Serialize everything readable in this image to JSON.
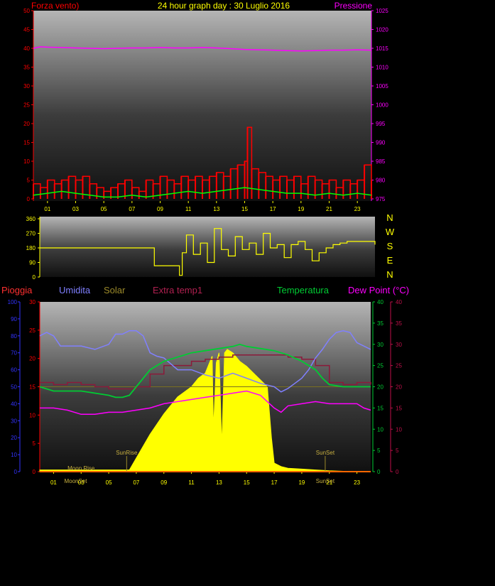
{
  "title": "24 hour graph day : 30 Luglio 2016",
  "colors": {
    "background": "#000000",
    "wind": "#ff0000",
    "gust": "#ffffff",
    "avg_wind": "#00ff00",
    "pressure": "#ff00ff",
    "direction": "#ffff00",
    "rain": "#3333ff",
    "humidity": "#8080ff",
    "solar": "#ffff00",
    "extra_temp": "#8b1a3a",
    "temperature": "#00cc33",
    "dew_point": "#ff00ff",
    "axis_label": "#ffff00"
  },
  "chart_data": [
    {
      "type": "line",
      "name": "wind-pressure",
      "labels": {
        "left": "Forza vento)",
        "right": "Pressione"
      },
      "x_ticks": [
        "01",
        "03",
        "05",
        "07",
        "09",
        "11",
        "13",
        "15",
        "17",
        "19",
        "21",
        "23"
      ],
      "x_tick_hours": [
        1,
        3,
        5,
        7,
        9,
        11,
        13,
        15,
        17,
        19,
        21,
        23
      ],
      "xlim": [
        0,
        24
      ],
      "left_axis": {
        "ticks": [
          0,
          5,
          10,
          15,
          20,
          25,
          30,
          35,
          40,
          45,
          50
        ],
        "ylim": [
          0,
          50
        ]
      },
      "right_axis": {
        "ticks": [
          975,
          980,
          985,
          990,
          995,
          1000,
          1005,
          1010,
          1015,
          1020,
          1025
        ],
        "ylim": [
          975,
          1025
        ]
      },
      "series": [
        {
          "key": "wind_max",
          "axis": "left",
          "x": [
            0,
            0.5,
            1,
            1.5,
            2,
            2.5,
            3,
            3.5,
            4,
            4.5,
            5,
            5.5,
            6,
            6.5,
            7,
            7.5,
            8,
            8.5,
            9,
            9.5,
            10,
            10.5,
            11,
            11.5,
            12,
            12.5,
            13,
            13.5,
            14,
            14.5,
            15,
            15.2,
            15.5,
            16,
            16.5,
            17,
            17.5,
            18,
            18.5,
            19,
            19.5,
            20,
            20.5,
            21,
            21.5,
            22,
            22.5,
            23,
            23.5,
            24
          ],
          "y": [
            4,
            3,
            5,
            4,
            5,
            6,
            5,
            6,
            4,
            3,
            2,
            3,
            4,
            5,
            3,
            2,
            5,
            4,
            6,
            5,
            4,
            6,
            5,
            6,
            5,
            6,
            7,
            6,
            8,
            9,
            10,
            19,
            8,
            7,
            6,
            5,
            6,
            5,
            6,
            4,
            6,
            5,
            4,
            5,
            3,
            5,
            4,
            5,
            9,
            5
          ]
        },
        {
          "key": "wind_avg",
          "axis": "left",
          "x": [
            0,
            1,
            2,
            3,
            4,
            5,
            6,
            7,
            8,
            9,
            10,
            11,
            12,
            13,
            14,
            15,
            16,
            17,
            18,
            19,
            20,
            21,
            22,
            23,
            24
          ],
          "y": [
            1,
            1.5,
            2,
            1.5,
            1,
            0.5,
            0.5,
            1,
            0.5,
            1,
            1.5,
            2,
            1.5,
            2,
            2.5,
            3,
            2.5,
            2,
            1.5,
            1.5,
            1,
            1.5,
            1,
            1.5,
            1
          ]
        },
        {
          "key": "pressure",
          "axis": "right",
          "x": [
            0,
            0.5,
            1,
            2,
            3,
            4,
            5,
            6,
            7,
            8,
            9,
            10,
            11,
            12,
            13,
            14,
            15,
            16,
            17,
            18,
            19,
            20,
            21,
            22,
            23,
            24
          ],
          "y": [
            1015,
            1015.4,
            1015.3,
            1015.2,
            1015.1,
            1015,
            1014.9,
            1015,
            1015.1,
            1015.1,
            1015.2,
            1015.1,
            1015.1,
            1015.2,
            1015.1,
            1014.9,
            1014.7,
            1014.6,
            1014.5,
            1014.4,
            1014.3,
            1014.4,
            1014.5,
            1014.5,
            1014.6,
            1014.5
          ]
        }
      ]
    },
    {
      "type": "line",
      "name": "wind-direction",
      "labels": {
        "compass": [
          "N",
          "W",
          "S",
          "E",
          "N"
        ]
      },
      "xlim": [
        0,
        24
      ],
      "y_axis": {
        "ticks": [
          0,
          90,
          180,
          270,
          360
        ],
        "ylim": [
          0,
          360
        ]
      },
      "series": [
        {
          "key": "direction",
          "x": [
            0,
            1,
            2,
            3,
            4,
            5,
            6,
            7,
            8,
            8.2,
            9,
            9.5,
            10,
            10.2,
            10.5,
            11,
            11.5,
            12,
            12.5,
            13,
            13.5,
            14,
            14.5,
            15,
            15.5,
            16,
            16.5,
            17,
            17.5,
            18,
            18.5,
            19,
            19.5,
            20,
            20.5,
            21,
            21.5,
            22,
            23,
            24
          ],
          "y": [
            180,
            180,
            180,
            180,
            180,
            180,
            180,
            180,
            180,
            70,
            70,
            70,
            10,
            150,
            260,
            140,
            210,
            90,
            300,
            170,
            130,
            250,
            170,
            210,
            140,
            270,
            180,
            200,
            120,
            200,
            220,
            170,
            100,
            150,
            180,
            200,
            210,
            220,
            220,
            200
          ]
        }
      ]
    },
    {
      "type": "line",
      "name": "humidity-temperature-solar",
      "labels": {
        "rain": "Pioggia",
        "humidity": "Umidita",
        "solar": "Solar",
        "extra_temp": "Extra temp1",
        "temperature": "Temperatura",
        "dew_point": "Dew Point (°C)"
      },
      "x_ticks": [
        "01",
        "03",
        "05",
        "07",
        "09",
        "11",
        "13",
        "15",
        "17",
        "19",
        "21",
        "23"
      ],
      "x_tick_hours": [
        1,
        3,
        5,
        7,
        9,
        11,
        13,
        15,
        17,
        19,
        21,
        23
      ],
      "xlim": [
        0,
        24
      ],
      "axes": {
        "rain": {
          "ticks": [
            0,
            10,
            20,
            30,
            40,
            50,
            60,
            70,
            80,
            90,
            100
          ],
          "ylim": [
            0,
            100
          ]
        },
        "humidity": {
          "ticks": [
            0,
            5,
            10,
            15,
            20,
            25,
            30
          ],
          "ylim": [
            0,
            30
          ]
        },
        "temperature": {
          "ticks": [
            0,
            5,
            10,
            15,
            20,
            25,
            30,
            35,
            40
          ],
          "ylim": [
            0,
            40
          ]
        },
        "dew_point": {
          "ticks": [
            0,
            5,
            10,
            15,
            20,
            25,
            30,
            35,
            40
          ],
          "ylim": [
            0,
            40
          ]
        }
      },
      "annotations": [
        {
          "text": "Moon Rise",
          "hour": 3
        },
        {
          "text": "MoonSet",
          "hour": 2.6
        },
        {
          "text": "SunRise",
          "hour": 6.3
        },
        {
          "text": "SunSet",
          "hour": 20.7
        }
      ],
      "series": [
        {
          "key": "humidity",
          "axis": "rain",
          "x": [
            0,
            0.5,
            1,
            1.5,
            2,
            3,
            4,
            5,
            5.5,
            6,
            6.5,
            7,
            7.5,
            8,
            8.5,
            9,
            10,
            11,
            12,
            13,
            14,
            15,
            16,
            17,
            17.5,
            18,
            18.5,
            19,
            19.5,
            20,
            20.5,
            21,
            21.5,
            22,
            22.5,
            23,
            24
          ],
          "y": [
            80,
            82,
            80,
            74,
            74,
            74,
            72,
            75,
            81,
            81,
            83,
            83,
            80,
            70,
            68,
            67,
            60,
            60,
            57,
            55,
            58,
            55,
            52,
            50,
            47,
            49,
            52,
            55,
            60,
            67,
            72,
            78,
            82,
            83,
            82,
            76,
            72
          ]
        },
        {
          "key": "temperature",
          "axis": "temperature",
          "x": [
            0,
            0.5,
            1,
            2,
            3,
            4,
            5,
            5.5,
            6,
            6.5,
            7,
            8,
            9,
            10,
            11,
            12,
            13,
            14,
            14.5,
            15,
            16,
            17,
            18,
            19,
            20,
            20.5,
            21,
            22,
            23,
            24
          ],
          "y": [
            20,
            19.5,
            19,
            19,
            19,
            18.5,
            18,
            17.5,
            17.5,
            18,
            20,
            24,
            26,
            27,
            28,
            28.5,
            29,
            29.5,
            30,
            29.5,
            29,
            28.5,
            27.5,
            26,
            24,
            22,
            20.5,
            20,
            20,
            20
          ]
        },
        {
          "key": "extra_temp",
          "axis": "dew_point",
          "x": [
            0,
            1,
            2,
            3,
            4,
            5,
            6,
            7,
            8,
            9,
            10,
            11,
            12,
            13,
            14,
            15,
            16,
            17,
            18,
            19,
            20,
            21,
            22,
            23,
            24
          ],
          "y": [
            21,
            20.5,
            21,
            20.5,
            20,
            19.5,
            19.5,
            20,
            23,
            25,
            25,
            26,
            26.5,
            27,
            27.5,
            27.5,
            27.5,
            27.5,
            27,
            26.5,
            25,
            21,
            20.5,
            21,
            20.5
          ]
        },
        {
          "key": "dew_point",
          "axis": "dew_point",
          "x": [
            0,
            1,
            2,
            3,
            4,
            5,
            6,
            7,
            8,
            9,
            10,
            11,
            12,
            13,
            14,
            15,
            16,
            16.5,
            17,
            17.5,
            18,
            19,
            20,
            21,
            22,
            23,
            23.5,
            24
          ],
          "y": [
            15,
            15,
            14.5,
            13.5,
            13.5,
            14,
            14,
            14.5,
            15,
            16,
            16.5,
            17,
            17.5,
            18,
            18.5,
            19,
            18,
            16.5,
            15,
            14,
            15.5,
            16,
            16.5,
            16,
            16,
            16,
            15,
            14.5
          ]
        },
        {
          "key": "solar",
          "axis": "rain",
          "x": [
            0,
            6.5,
            7,
            8,
            9,
            10,
            11,
            11.5,
            12,
            12.5,
            12.6,
            12.8,
            13,
            13.2,
            13.4,
            13.6,
            14,
            14.5,
            15,
            15.5,
            16,
            16.5,
            16.8,
            17,
            17.5,
            18,
            19,
            20,
            21,
            22,
            24
          ],
          "y": [
            1,
            1,
            8,
            22,
            34,
            44,
            50,
            55,
            58,
            68,
            25,
            64,
            70,
            15,
            70,
            72,
            70,
            65,
            62,
            58,
            54,
            50,
            20,
            5,
            3,
            2,
            1.5,
            1,
            0.5,
            0.2,
            0
          ]
        }
      ]
    }
  ]
}
